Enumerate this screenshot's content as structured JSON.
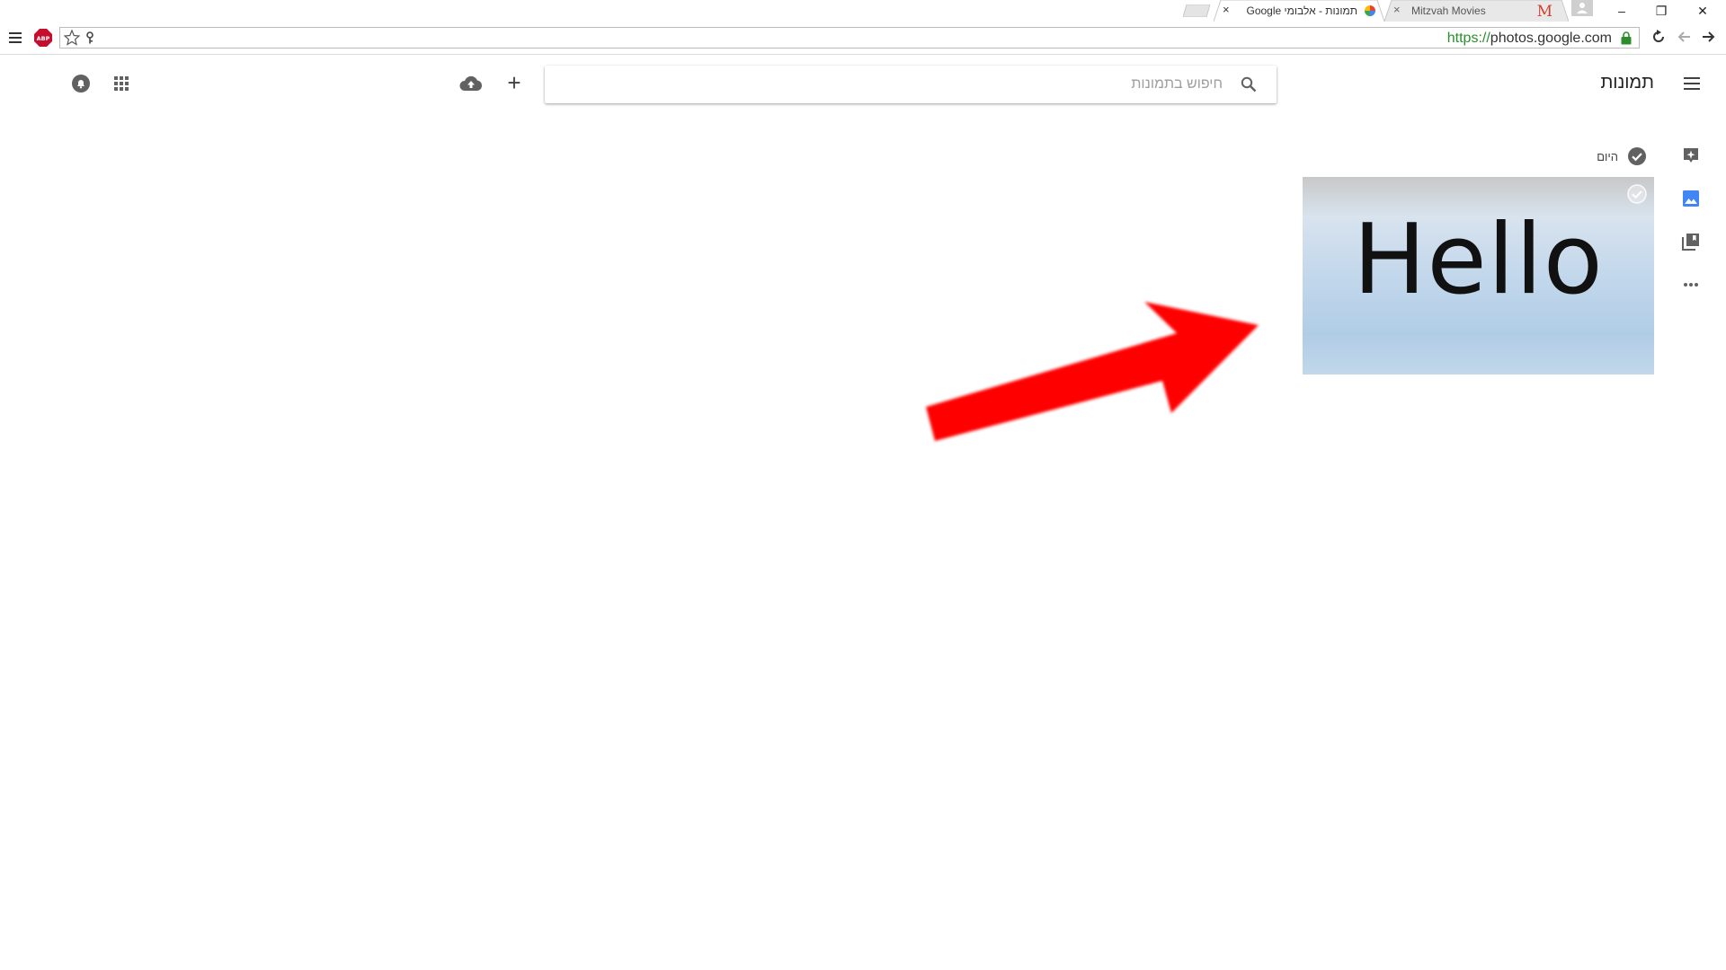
{
  "browser": {
    "tabs": [
      {
        "title": "תמונות - אלבומי Google",
        "active": true
      },
      {
        "title": "Mitzvah Movies",
        "active": false,
        "favicon_letter": "M"
      }
    ],
    "close_glyph": "×",
    "window_controls": {
      "minimize": "–",
      "restore": "❐",
      "close": "✕"
    },
    "url": {
      "scheme": "https://",
      "host": "photos.google.com"
    }
  },
  "app": {
    "title": "תמונות",
    "search_placeholder": "חיפוש בתמונות",
    "add_glyph": "+"
  },
  "side_nav": [
    "assistant-icon",
    "photos-icon",
    "albums-icon",
    "more-icon"
  ],
  "content": {
    "date_label": "היום",
    "photo_text": "Hello"
  },
  "colors": {
    "accent_blue": "#4285f4",
    "icon_grey": "#616161",
    "annotation_red": "#ff0000"
  }
}
